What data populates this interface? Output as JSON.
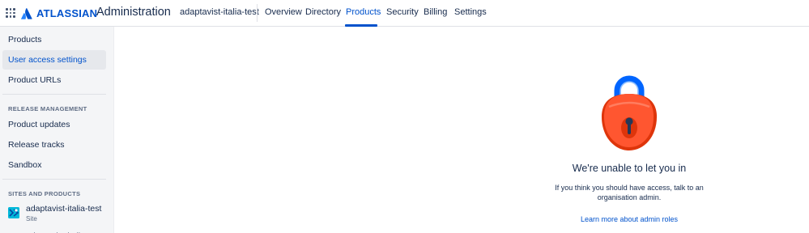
{
  "header": {
    "app_switcher_icon": "app-switcher-grid-icon",
    "brand": "ATLASSIAN",
    "product": "Administration",
    "organization": "adaptavist-italia-test",
    "tabs": [
      {
        "label": "Overview",
        "active": false
      },
      {
        "label": "Directory",
        "active": false
      },
      {
        "label": "Products",
        "active": true
      },
      {
        "label": "Security",
        "active": false
      },
      {
        "label": "Billing",
        "active": false
      },
      {
        "label": "Settings",
        "active": false
      }
    ],
    "accent_color": "#0052cc"
  },
  "sidebar": {
    "items": [
      {
        "label": "Products",
        "selected": false
      },
      {
        "label": "User access settings",
        "selected": true
      },
      {
        "label": "Product URLs",
        "selected": false
      }
    ],
    "release_heading": "RELEASE MANAGEMENT",
    "release_items": [
      {
        "label": "Product updates"
      },
      {
        "label": "Release tracks"
      },
      {
        "label": "Sandbox"
      }
    ],
    "sites_heading": "SITES AND PRODUCTS",
    "site": {
      "name": "adaptavist-italia-test",
      "type": "Site",
      "icon": "site-logo-icon"
    },
    "site_partial": "adaptavist-italia-test"
  },
  "main": {
    "illustration": "padlock-icon",
    "title": "We're unable to let you in",
    "body_line1": "If you think you should have access, talk to an",
    "body_line2": "organisation admin.",
    "link": "Learn more about admin roles",
    "lock_colors": {
      "body": "#ff5630",
      "shackle": "#0065ff"
    }
  }
}
